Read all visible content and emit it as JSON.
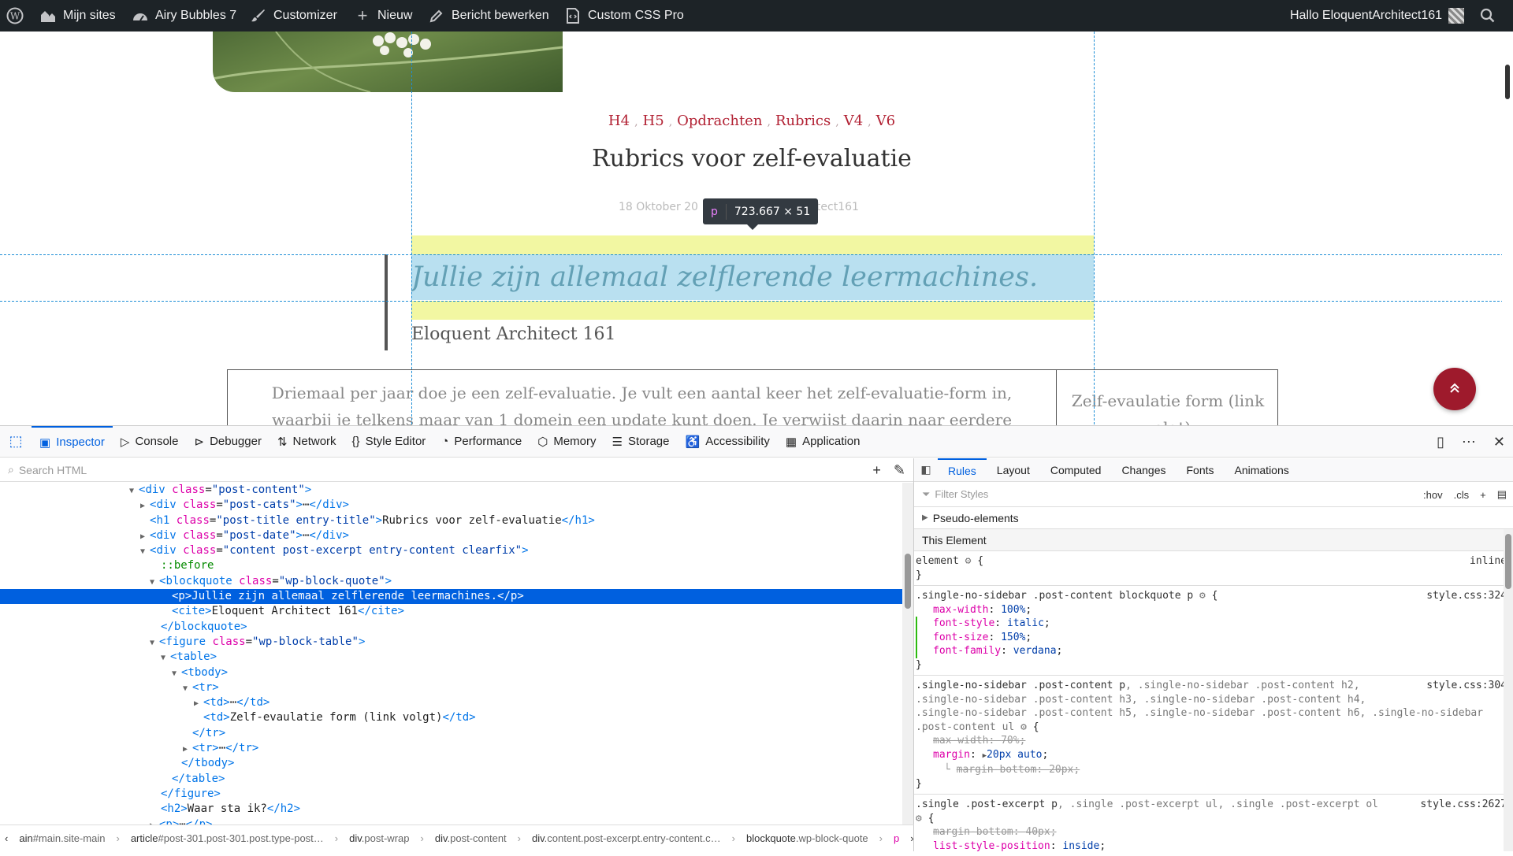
{
  "admin_bar": {
    "wp_logo_icon": "wordpress-icon",
    "my_sites": "Mijn sites",
    "site_name": "Airy Bubbles 7",
    "customizer": "Customizer",
    "new": "Nieuw",
    "edit_post": "Bericht bewerken",
    "custom_css": "Custom CSS Pro",
    "greeting": "Hallo EloquentArchitect161"
  },
  "post": {
    "categories": [
      "H4",
      "H5",
      "Opdrachten",
      "Rubrics",
      "V4",
      "V6"
    ],
    "title": "Rubrics voor zelf-evaluatie",
    "date_partial": "18 Oktober 20",
    "author_partial": "rchitect161",
    "quote": "Jullie zijn allemaal zelflerende leermachines.",
    "cite": "Eloquent Architect 161",
    "table_cell_1": "Driemaal per jaar doe je een zelf-evaluatie. Je vult een aantal keer het zelf-evaluatie-form in, waarbij je telkens maar van 1 domein een update kunt doen. Je verwijst daarin naar eerdere scrapbooks en projecten",
    "table_cell_2": "Zelf-evaulatie form (link volgt)",
    "fab_icon": "double-chevron-up-icon"
  },
  "highlighter": {
    "tag": "p",
    "size": "723.667 × 51"
  },
  "devtools": {
    "tabs": [
      "Inspector",
      "Console",
      "Debugger",
      "Network",
      "Style Editor",
      "Performance",
      "Memory",
      "Storage",
      "Accessibility",
      "Application"
    ],
    "search_placeholder": "Search HTML",
    "filter_placeholder": "Filter Styles",
    "right_tabs": [
      "Rules",
      "Layout",
      "Computed",
      "Changes",
      "Fonts",
      "Animations"
    ],
    "hov": ":hov",
    "cls": ".cls",
    "pseudo_elements": "Pseudo-elements",
    "this_element": "This Element",
    "breadcrumbs": [
      {
        "tag": "ain",
        "rest": "#main.site-main"
      },
      {
        "tag": "article",
        "rest": "#post-301.post-301.post.type-post…"
      },
      {
        "tag": "div",
        "rest": ".post-wrap"
      },
      {
        "tag": "div",
        "rest": ".post-content"
      },
      {
        "tag": "div",
        "rest": ".content.post-excerpt.entry-content.c…"
      },
      {
        "tag": "blockquote",
        "rest": ".wp-block-quote"
      },
      {
        "tag": "p",
        "rest": ""
      }
    ]
  },
  "tree": {
    "r1": "div",
    "r1_cls": "post-content",
    "r2": "div",
    "r2_cls": "post-cats",
    "r3_tag": "h1",
    "r3_cls": "post-title entry-title",
    "r3_text": "Rubrics voor zelf-evaluatie",
    "r4": "div",
    "r4_cls": "post-date",
    "r5": "div",
    "r5_cls": "content post-excerpt entry-content clearfix",
    "r6": "::before",
    "r7": "blockquote",
    "r7_cls": "wp-block-quote",
    "r8_text": "Jullie zijn allemaal zelflerende leermachines.",
    "r9_text": "Eloquent Architect 161",
    "r11_cls": "wp-block-table",
    "r16_text": "Zelf-evaulatie form (link volgt)",
    "r21_text": "Waar sta ik?"
  },
  "rules": {
    "element_sel": "element",
    "element_src": "inline",
    "r1_sel": ".single-no-sidebar .post-content blockquote p",
    "r1_src": "style.css:324",
    "r1_props": [
      {
        "n": "max-width",
        "v": "100%"
      },
      {
        "n": "font-style",
        "v": "italic"
      },
      {
        "n": "font-size",
        "v": "150%"
      },
      {
        "n": "font-family",
        "v": "verdana"
      }
    ],
    "r2_sel_a": ".single-no-sidebar .post-content p",
    "r2_sel_b": ", .single-no-sidebar .post-content h2,",
    "r2_sel_c": ".single-no-sidebar .post-content h3, .single-no-sidebar .post-content h4,",
    "r2_sel_d": ".single-no-sidebar .post-content h5, .single-no-sidebar .post-content h6, .single-no-sidebar",
    "r2_sel_e": ".post-content ul",
    "r2_src": "style.css:304",
    "r2_p1n": "max-width",
    "r2_p1v": "70%",
    "r2_p2n": "margin",
    "r2_p2v": "20px auto",
    "r2_p3n": "margin-bottom",
    "r2_p3v": "20px",
    "r3_sel_a": ".single .post-excerpt p",
    "r3_sel_b": ", .single .post-excerpt ul, .single .post-excerpt ol",
    "r3_src": "style.css:2627",
    "r3_p1n": "margin-bottom",
    "r3_p1v": "40px",
    "r3_p2n": "list-style-position",
    "r3_p2v": "inside"
  }
}
